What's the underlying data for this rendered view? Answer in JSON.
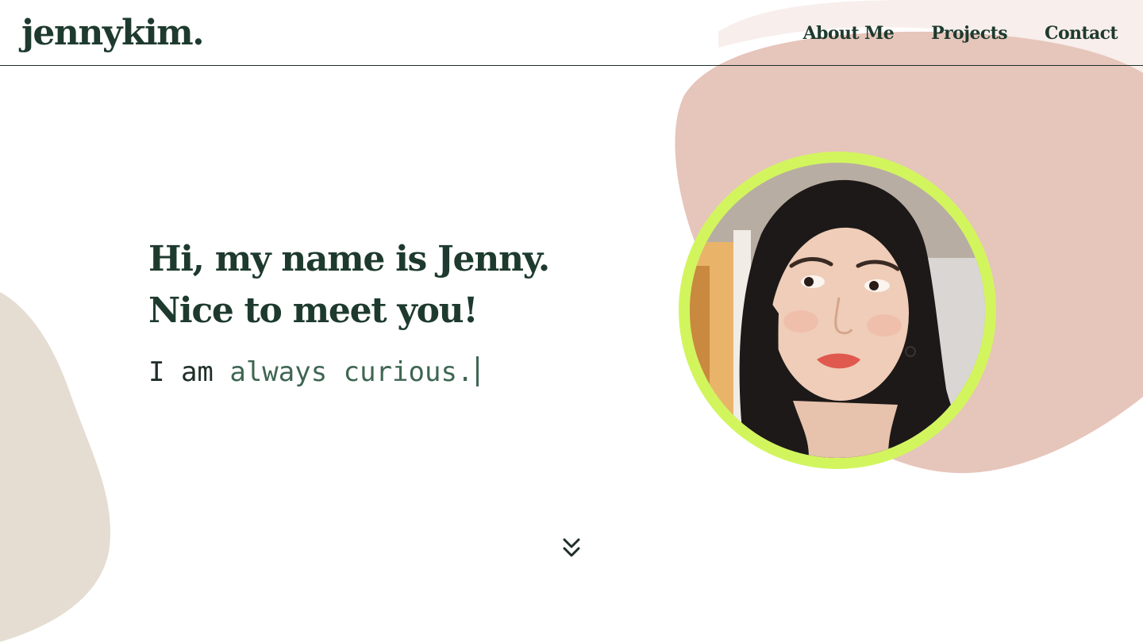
{
  "header": {
    "logo": "jennykim.",
    "nav": [
      {
        "label": "About Me"
      },
      {
        "label": "Projects"
      },
      {
        "label": "Contact"
      }
    ]
  },
  "hero": {
    "line1": "Hi, my name is Jenny.",
    "line2": "Nice to meet you!",
    "typing_prefix": "I am ",
    "typing_word": "always curious."
  },
  "portrait": {
    "icon": "profile-photo"
  },
  "scroll": {
    "icon": "double-chevron-down-icon"
  },
  "colors": {
    "text_dark": "#1e3a2e",
    "accent_green": "#3f6652",
    "ring_lime": "#d2f55e",
    "blob_pink": "#e6c5bb",
    "blob_beige": "#e5ddd2"
  }
}
